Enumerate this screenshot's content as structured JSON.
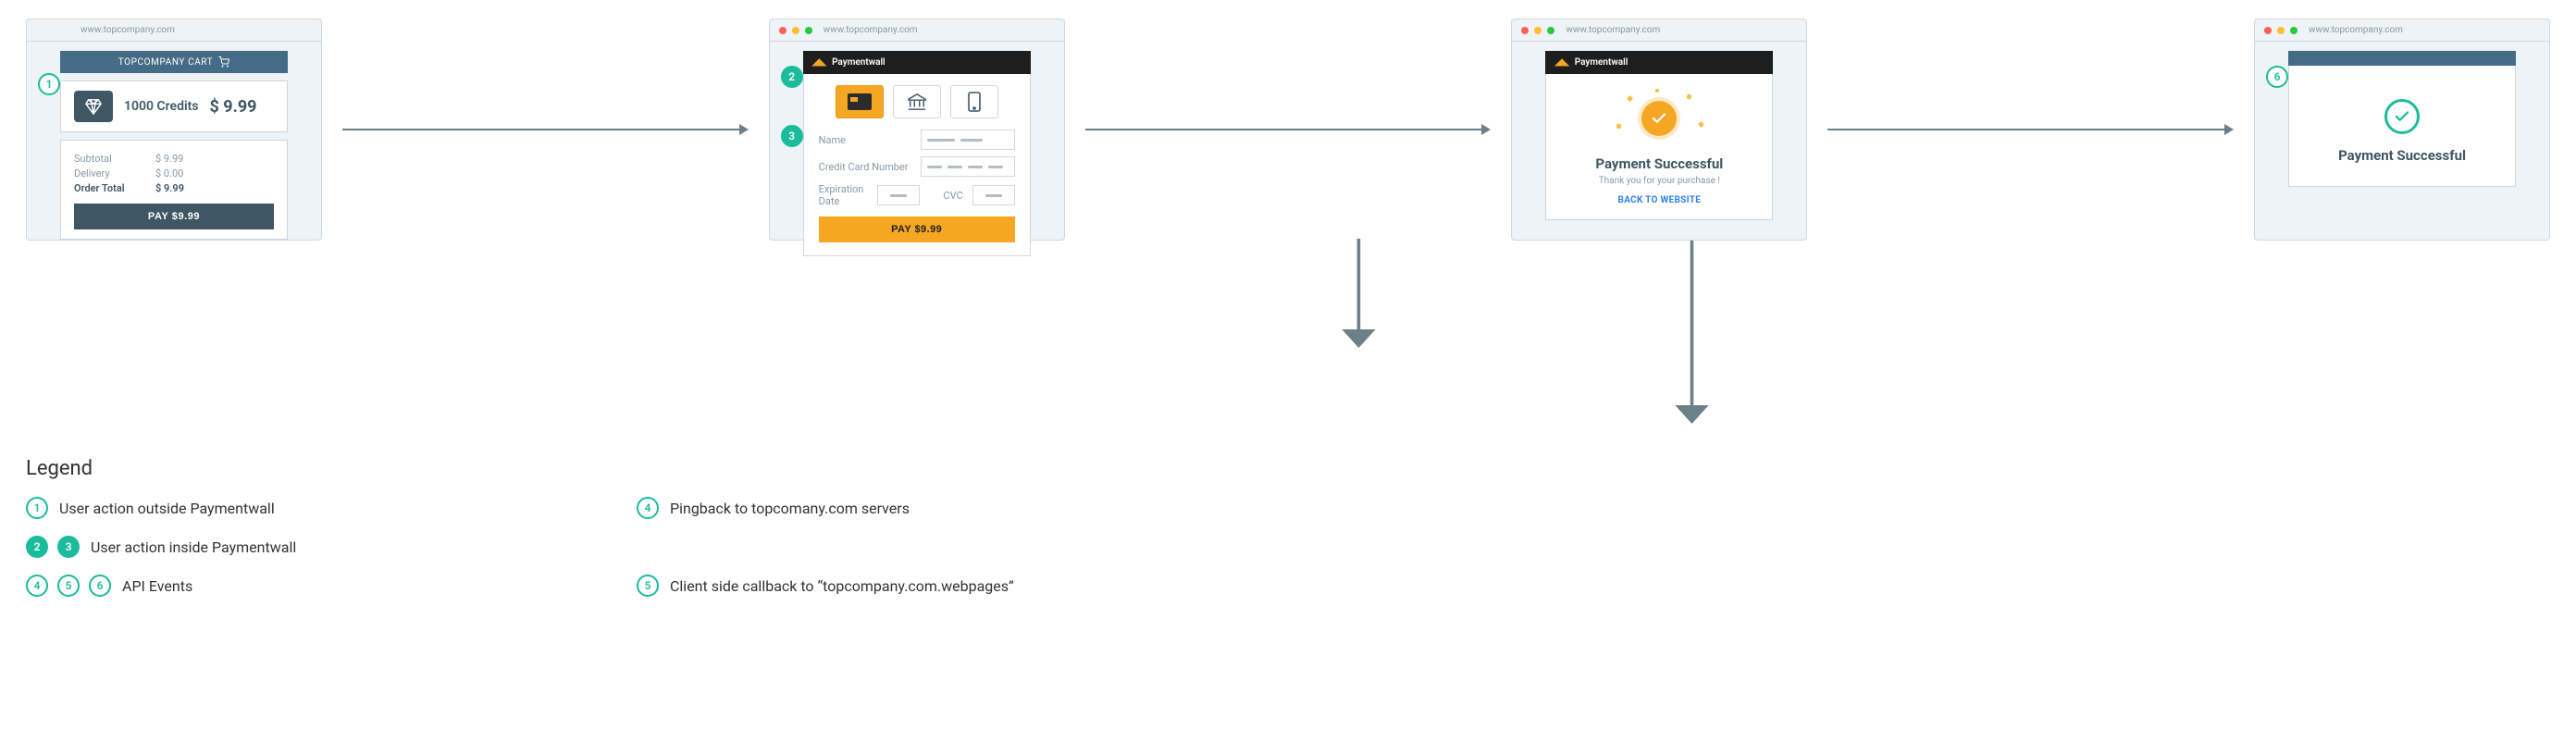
{
  "url": "www.topcompany.com",
  "paymentwall_brand": "Paymentwall",
  "steps": {
    "s1": "1",
    "s2": "2",
    "s3": "3",
    "s4": "4",
    "s5": "5",
    "s6": "6"
  },
  "cart": {
    "header": "TOPCOMPANY CART",
    "product": "1000 Credits",
    "product_price": "$ 9.99",
    "rows": {
      "subtotal_label": "Subtotal",
      "subtotal_value": "$ 9.99",
      "delivery_label": "Delivery",
      "delivery_value": "$ 0.00",
      "total_label": "Order Total",
      "total_value": "$ 9.99"
    },
    "pay_button": "PAY $9.99"
  },
  "form": {
    "name_label": "Name",
    "cc_label": "Credit Card Number",
    "exp_label": "Expiration Date",
    "cvc_label": "CVC",
    "pay_button": "PAY $9.99"
  },
  "success": {
    "title": "Payment Successful",
    "subtitle": "Thank you for your purchase !",
    "back": "BACK TO WEBSITE"
  },
  "confirm": {
    "title": "Payment Successful"
  },
  "legend": {
    "heading": "Legend",
    "l1": "User action outside Paymentwall",
    "l2": "User action inside Paymentwall",
    "l3": "API Events",
    "r4": "Pingback to topcomany.com servers",
    "r5": "Client side callback to “topcompany.com.webpages”"
  }
}
